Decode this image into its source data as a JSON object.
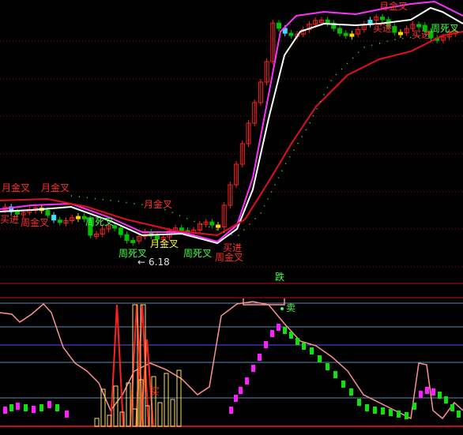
{
  "colors": {
    "up_candle": "#ff2020",
    "down_candle": "#00c000",
    "neutral_candle": "#40e0ff",
    "highlight_candle": "#ffd800",
    "ma_white": "#ffffff",
    "ma_magenta": "#ff30ff",
    "ma_red": "#e01020",
    "ma_dotted": "#40ff40",
    "osc_line": "#ff9090",
    "osc_bar_up": "#ff20ff",
    "osc_bar_down": "#10e010",
    "osc_spike_red": "#ff2020",
    "osc_spike_yellow": "#ffe060",
    "grid_dotted": "#8a1010",
    "osc_grid": "#80c0ff",
    "divider": "#c01010",
    "label_red": "#ff3030",
    "label_yellow": "#ffff40",
    "label_green": "#40ff40",
    "label_white": "#e0e0e0"
  },
  "chart_data": [
    {
      "type": "candlestick",
      "panel": "price",
      "grid": true,
      "annotations": [
        {
          "text": "月金叉",
          "x": 4,
          "color": "red"
        },
        {
          "text": "月金叉",
          "x": 8,
          "color": "red"
        },
        {
          "text": "买进",
          "x": 0,
          "color": "red"
        },
        {
          "text": "周金叉",
          "x": 3,
          "color": "red"
        },
        {
          "text": "周死叉",
          "x": 11,
          "color": "green"
        },
        {
          "text": "月金叉",
          "x": 21,
          "color": "red"
        },
        {
          "text": "月金叉",
          "x": 25,
          "color": "yellow"
        },
        {
          "text": "周死叉",
          "x": 17,
          "color": "green"
        },
        {
          "text": "周死叉",
          "x": 32,
          "color": "green"
        },
        {
          "text": "买进",
          "x": 36,
          "color": "red"
        },
        {
          "text": "周金叉",
          "x": 34,
          "color": "red"
        },
        {
          "text": "月金叉",
          "x": 56,
          "color": "red"
        },
        {
          "text": "买进",
          "x": 57,
          "color": "red"
        },
        {
          "text": "买进",
          "x": 65,
          "color": "red"
        },
        {
          "text": "周死叉",
          "x": 68,
          "color": "green"
        },
        {
          "text": "6.18",
          "x": 20,
          "color": "white"
        },
        {
          "text": "跌",
          "x": 42,
          "color": "green"
        }
      ]
    },
    {
      "type": "line",
      "panel": "oscillator",
      "grid": true,
      "annotations": [
        {
          "text": "卖",
          "x": 44,
          "color": "green"
        },
        {
          "text": "买",
          "x": 22,
          "color": "red"
        }
      ]
    }
  ],
  "labels": {
    "l1": "月金叉",
    "l2": "月金叉",
    "l3": "买进",
    "l4": "周金叉",
    "l5": "周死叉",
    "l6": "月金叉",
    "l7": "月金叉",
    "l8": "周死叉",
    "l9": "周死叉",
    "l10": "买进",
    "l11": "周金叉",
    "l12": "月金叉",
    "l13": "买进",
    "l14": "买进",
    "l15": "周死叉",
    "l16": "6.18",
    "l17": "跌",
    "l18": "卖",
    "l19": "买"
  }
}
